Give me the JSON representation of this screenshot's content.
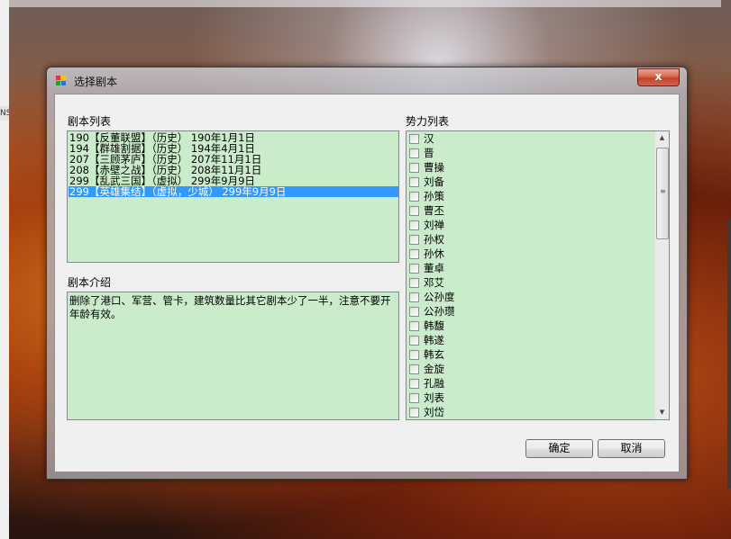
{
  "window": {
    "title": "选择剧本",
    "close_label": "x"
  },
  "scenarios": {
    "label": "剧本列表",
    "items": [
      "190【反董联盟】（历史） 190年1月1日",
      "194【群雄割据】（历史） 194年4月1日",
      "207【三顾茅庐】（历史） 207年11月1日",
      "208【赤壁之战】（历史） 208年11月1日",
      "299【乱武三国】（虚拟） 299年9月9日",
      "299【英雄集结】（虚拟，少城） 299年9月9日"
    ],
    "selected_index": 5
  },
  "intro": {
    "label": "剧本介绍",
    "text": "删除了港口、军营、管卡，建筑数量比其它剧本少了一半，注意不要开年龄有效。"
  },
  "factions": {
    "label": "势力列表",
    "items": [
      "汉",
      "晋",
      "曹操",
      "刘备",
      "孙策",
      "曹丕",
      "刘禅",
      "孙权",
      "孙休",
      "董卓",
      "邓艾",
      "公孙度",
      "公孙瓒",
      "韩馥",
      "韩遂",
      "韩玄",
      "金旋",
      "孔融",
      "刘表",
      "刘岱"
    ]
  },
  "buttons": {
    "ok": "确定",
    "cancel": "取消"
  },
  "background": {
    "left_tab_text": "NS"
  }
}
